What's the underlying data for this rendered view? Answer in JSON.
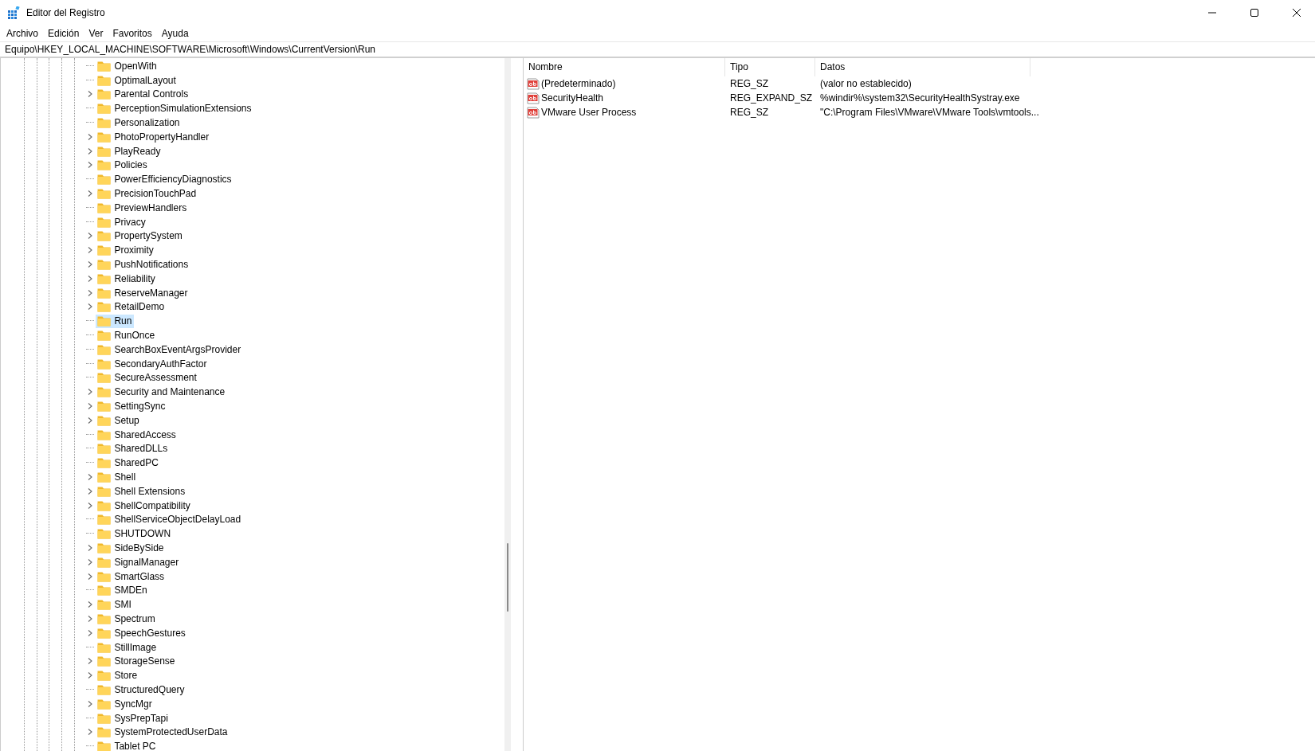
{
  "window": {
    "title": "Editor del Registro"
  },
  "menu": [
    "Archivo",
    "Edición",
    "Ver",
    "Favoritos",
    "Ayuda"
  ],
  "address": "Equipo\\HKEY_LOCAL_MACHINE\\SOFTWARE\\Microsoft\\Windows\\CurrentVersion\\Run",
  "tree": {
    "items": [
      {
        "label": "OpenWith",
        "expandable": false,
        "selected": false
      },
      {
        "label": "OptimalLayout",
        "expandable": false,
        "selected": false
      },
      {
        "label": "Parental Controls",
        "expandable": true,
        "selected": false
      },
      {
        "label": "PerceptionSimulationExtensions",
        "expandable": false,
        "selected": false
      },
      {
        "label": "Personalization",
        "expandable": false,
        "selected": false
      },
      {
        "label": "PhotoPropertyHandler",
        "expandable": true,
        "selected": false
      },
      {
        "label": "PlayReady",
        "expandable": true,
        "selected": false
      },
      {
        "label": "Policies",
        "expandable": true,
        "selected": false
      },
      {
        "label": "PowerEfficiencyDiagnostics",
        "expandable": false,
        "selected": false
      },
      {
        "label": "PrecisionTouchPad",
        "expandable": true,
        "selected": false
      },
      {
        "label": "PreviewHandlers",
        "expandable": false,
        "selected": false
      },
      {
        "label": "Privacy",
        "expandable": false,
        "selected": false
      },
      {
        "label": "PropertySystem",
        "expandable": true,
        "selected": false
      },
      {
        "label": "Proximity",
        "expandable": true,
        "selected": false
      },
      {
        "label": "PushNotifications",
        "expandable": true,
        "selected": false
      },
      {
        "label": "Reliability",
        "expandable": true,
        "selected": false
      },
      {
        "label": "ReserveManager",
        "expandable": true,
        "selected": false
      },
      {
        "label": "RetailDemo",
        "expandable": true,
        "selected": false
      },
      {
        "label": "Run",
        "expandable": false,
        "selected": true
      },
      {
        "label": "RunOnce",
        "expandable": false,
        "selected": false
      },
      {
        "label": "SearchBoxEventArgsProvider",
        "expandable": false,
        "selected": false
      },
      {
        "label": "SecondaryAuthFactor",
        "expandable": false,
        "selected": false
      },
      {
        "label": "SecureAssessment",
        "expandable": false,
        "selected": false
      },
      {
        "label": "Security and Maintenance",
        "expandable": true,
        "selected": false
      },
      {
        "label": "SettingSync",
        "expandable": true,
        "selected": false
      },
      {
        "label": "Setup",
        "expandable": true,
        "selected": false
      },
      {
        "label": "SharedAccess",
        "expandable": false,
        "selected": false
      },
      {
        "label": "SharedDLLs",
        "expandable": false,
        "selected": false
      },
      {
        "label": "SharedPC",
        "expandable": false,
        "selected": false
      },
      {
        "label": "Shell",
        "expandable": true,
        "selected": false
      },
      {
        "label": "Shell Extensions",
        "expandable": true,
        "selected": false
      },
      {
        "label": "ShellCompatibility",
        "expandable": true,
        "selected": false
      },
      {
        "label": "ShellServiceObjectDelayLoad",
        "expandable": false,
        "selected": false
      },
      {
        "label": "SHUTDOWN",
        "expandable": false,
        "selected": false
      },
      {
        "label": "SideBySide",
        "expandable": true,
        "selected": false
      },
      {
        "label": "SignalManager",
        "expandable": true,
        "selected": false
      },
      {
        "label": "SmartGlass",
        "expandable": true,
        "selected": false
      },
      {
        "label": "SMDEn",
        "expandable": false,
        "selected": false
      },
      {
        "label": "SMI",
        "expandable": true,
        "selected": false
      },
      {
        "label": "Spectrum",
        "expandable": true,
        "selected": false
      },
      {
        "label": "SpeechGestures",
        "expandable": true,
        "selected": false
      },
      {
        "label": "StillImage",
        "expandable": false,
        "selected": false
      },
      {
        "label": "StorageSense",
        "expandable": true,
        "selected": false
      },
      {
        "label": "Store",
        "expandable": true,
        "selected": false
      },
      {
        "label": "StructuredQuery",
        "expandable": false,
        "selected": false
      },
      {
        "label": "SyncMgr",
        "expandable": true,
        "selected": false
      },
      {
        "label": "SysPrepTapi",
        "expandable": false,
        "selected": false
      },
      {
        "label": "SystemProtectedUserData",
        "expandable": true,
        "selected": false
      },
      {
        "label": "Tablet PC",
        "expandable": false,
        "selected": false
      }
    ]
  },
  "values": {
    "columns": [
      "Nombre",
      "Tipo",
      "Datos"
    ],
    "rows": [
      {
        "name": "(Predeterminado)",
        "type": "REG_SZ",
        "data": "(valor no establecido)"
      },
      {
        "name": "SecurityHealth",
        "type": "REG_EXPAND_SZ",
        "data": "%windir%\\system32\\SecurityHealthSystray.exe"
      },
      {
        "name": "VMware User Process",
        "type": "REG_SZ",
        "data": "\"C:\\Program Files\\VMware\\VMware Tools\\vmtools..."
      }
    ]
  }
}
